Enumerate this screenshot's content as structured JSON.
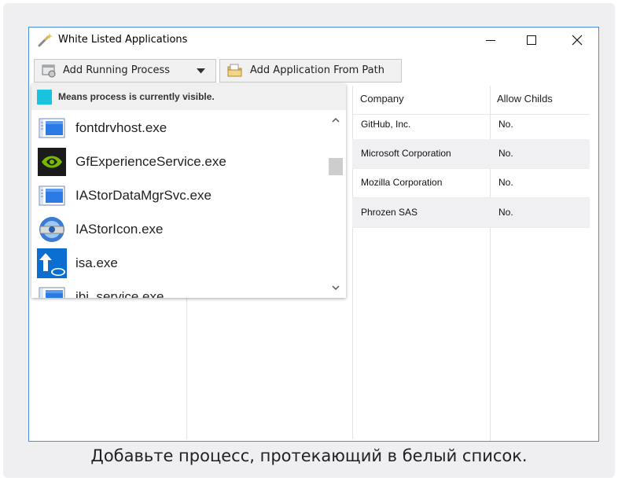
{
  "window": {
    "title": "White Listed Applications",
    "icons": [
      "wand-icon",
      "minimize-icon",
      "maximize-icon",
      "close-icon"
    ]
  },
  "toolbar": {
    "add_running_label": "Add Running Process",
    "add_path_label": "Add Application From Path"
  },
  "dropdown": {
    "legend_text": "Means process is currently visible.",
    "legend_color": "#19c3df",
    "items": [
      {
        "name": "fontdrvhost.exe",
        "icon": "window-app-icon"
      },
      {
        "name": "GfExperienceService.exe",
        "icon": "nvidia-icon"
      },
      {
        "name": "IAStorDataMgrSvc.exe",
        "icon": "window-app-icon"
      },
      {
        "name": "IAStorIcon.exe",
        "icon": "intel-storage-icon"
      },
      {
        "name": "isa.exe",
        "icon": "intel-update-icon"
      },
      {
        "name": "ibi_service.exe",
        "icon": "window-app-icon"
      }
    ]
  },
  "grid": {
    "headers": {
      "company": "Company",
      "allow_childs": "Allow Childs"
    },
    "rows": [
      {
        "company": "GitHub, Inc.",
        "allow_childs": "No."
      },
      {
        "company": "Microsoft Corporation",
        "allow_childs": "No."
      },
      {
        "company": "Mozilla Corporation",
        "allow_childs": "No."
      },
      {
        "company": "Phrozen SAS",
        "allow_childs": "No."
      }
    ]
  },
  "caption": "Добавьте процесс, протекающий в белый список."
}
